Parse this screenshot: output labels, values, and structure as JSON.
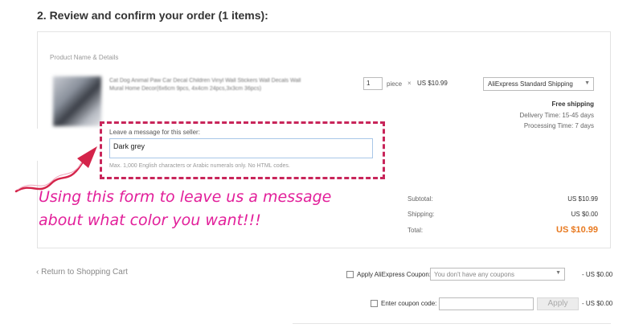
{
  "heading": "2. Review and confirm your order (1 items):",
  "table_header": "Product Name & Details",
  "product": {
    "title": "Cat Dog Animal Paw Car Decal Children Vinyl Wall Stickers Wall Decals Wall Mural Home Decor(6x6cm 9pcs, 4x4cm 24pcs,3x3cm 36pcs)",
    "quantity": "1",
    "unit": "piece",
    "times": "×",
    "price": "US $10.99"
  },
  "shipping": {
    "method": "AliExpress Standard Shipping",
    "free": "Free shipping",
    "delivery_time": "Delivery Time:  15-45 days",
    "processing_time": "Processing Time:  7 days"
  },
  "message": {
    "label": "Leave a message for this seller:",
    "value": "Dark grey",
    "hint": "Max. 1,000 English characters or Arabic numerals only. No HTML codes."
  },
  "callout": {
    "line1": "Using this form to leave us a message",
    "line2": "about what color you want!!!"
  },
  "summary": {
    "subtotal_label": "Subtotal:",
    "subtotal": "US $10.99",
    "shipping_label": "Shipping:",
    "shipping": "US $0.00",
    "total_label": "Total:",
    "total": "US $10.99"
  },
  "return_link": "‹ Return to Shopping Cart",
  "coupon": {
    "label": "Apply AliExpress Coupon:",
    "placeholder": "You don't have any coupons",
    "discount": "- US $0.00"
  },
  "code": {
    "label": "Enter coupon code:",
    "apply": "Apply",
    "discount": "- US $0.00"
  },
  "colors": {
    "callout": "#e21f9a",
    "dashed_border": "#c8255a",
    "total": "#e8791f"
  }
}
